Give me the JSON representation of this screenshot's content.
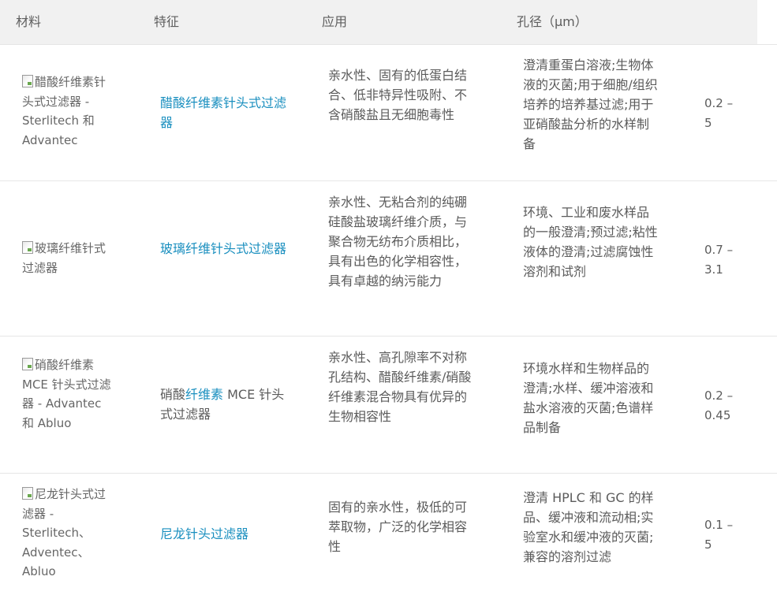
{
  "headers": {
    "material": "材料",
    "feature": "特征",
    "application": "应用",
    "pore": "孔径（μm）"
  },
  "rows": [
    {
      "image_alt": "醋酸纤维素针头式过滤器 - Sterlitech 和 Advantec",
      "feature_link": "醋酸纤维素针头式过滤器",
      "feature_prefix": "",
      "feature_suffix": "",
      "properties": "亲水性、固有的低蛋白结合、低非特异性吸附、不含硝酸盐且无细胞毒性",
      "application": "澄清重蛋白溶液;生物体液的灭菌;用于细胞/组织培养的培养基过滤;用于亚硝酸盐分析的水样制备",
      "pore": "0.2 – 5"
    },
    {
      "image_alt": "玻璃纤维针式过滤器",
      "feature_link": "玻璃纤维针头式过滤器",
      "feature_prefix": "",
      "feature_suffix": "",
      "properties": "亲水性、无粘合剂的纯硼硅酸盐玻璃纤维介质，与聚合物无纺布介质相比，具有出色的化学相容性，具有卓越的纳污能力",
      "application": "环境、工业和废水样品的一般澄清;预过滤;粘性液体的澄清;过滤腐蚀性溶剂和试剂",
      "pore": "0.7 – 3.1"
    },
    {
      "image_alt": "硝酸纤维素 MCE 针头式过滤器 - Advantec 和 Abluo",
      "feature_prefix": "硝酸",
      "feature_link": "纤维素",
      "feature_suffix": " MCE 针头式过滤器",
      "properties": "亲水性、高孔隙率不对称孔结构、醋酸纤维素/硝酸纤维素混合物具有优异的生物相容性",
      "application": "环境水样和生物样品的澄清;水样、缓冲溶液和盐水溶液的灭菌;色谱样品制备",
      "pore": "0.2 – 0.45"
    },
    {
      "image_alt": "尼龙针头式过滤器 - Sterlitech、Adventec、Abluo",
      "feature_link": "尼龙针头过滤器",
      "feature_prefix": "",
      "feature_suffix": "",
      "properties": "固有的亲水性，极低的可萃取物，广泛的化学相容性",
      "application": "澄清 HPLC 和 GC 的样品、缓冲液和流动相;实验室水和缓冲液的灭菌;兼容的溶剂过滤",
      "pore": "0.1 – 5"
    }
  ]
}
